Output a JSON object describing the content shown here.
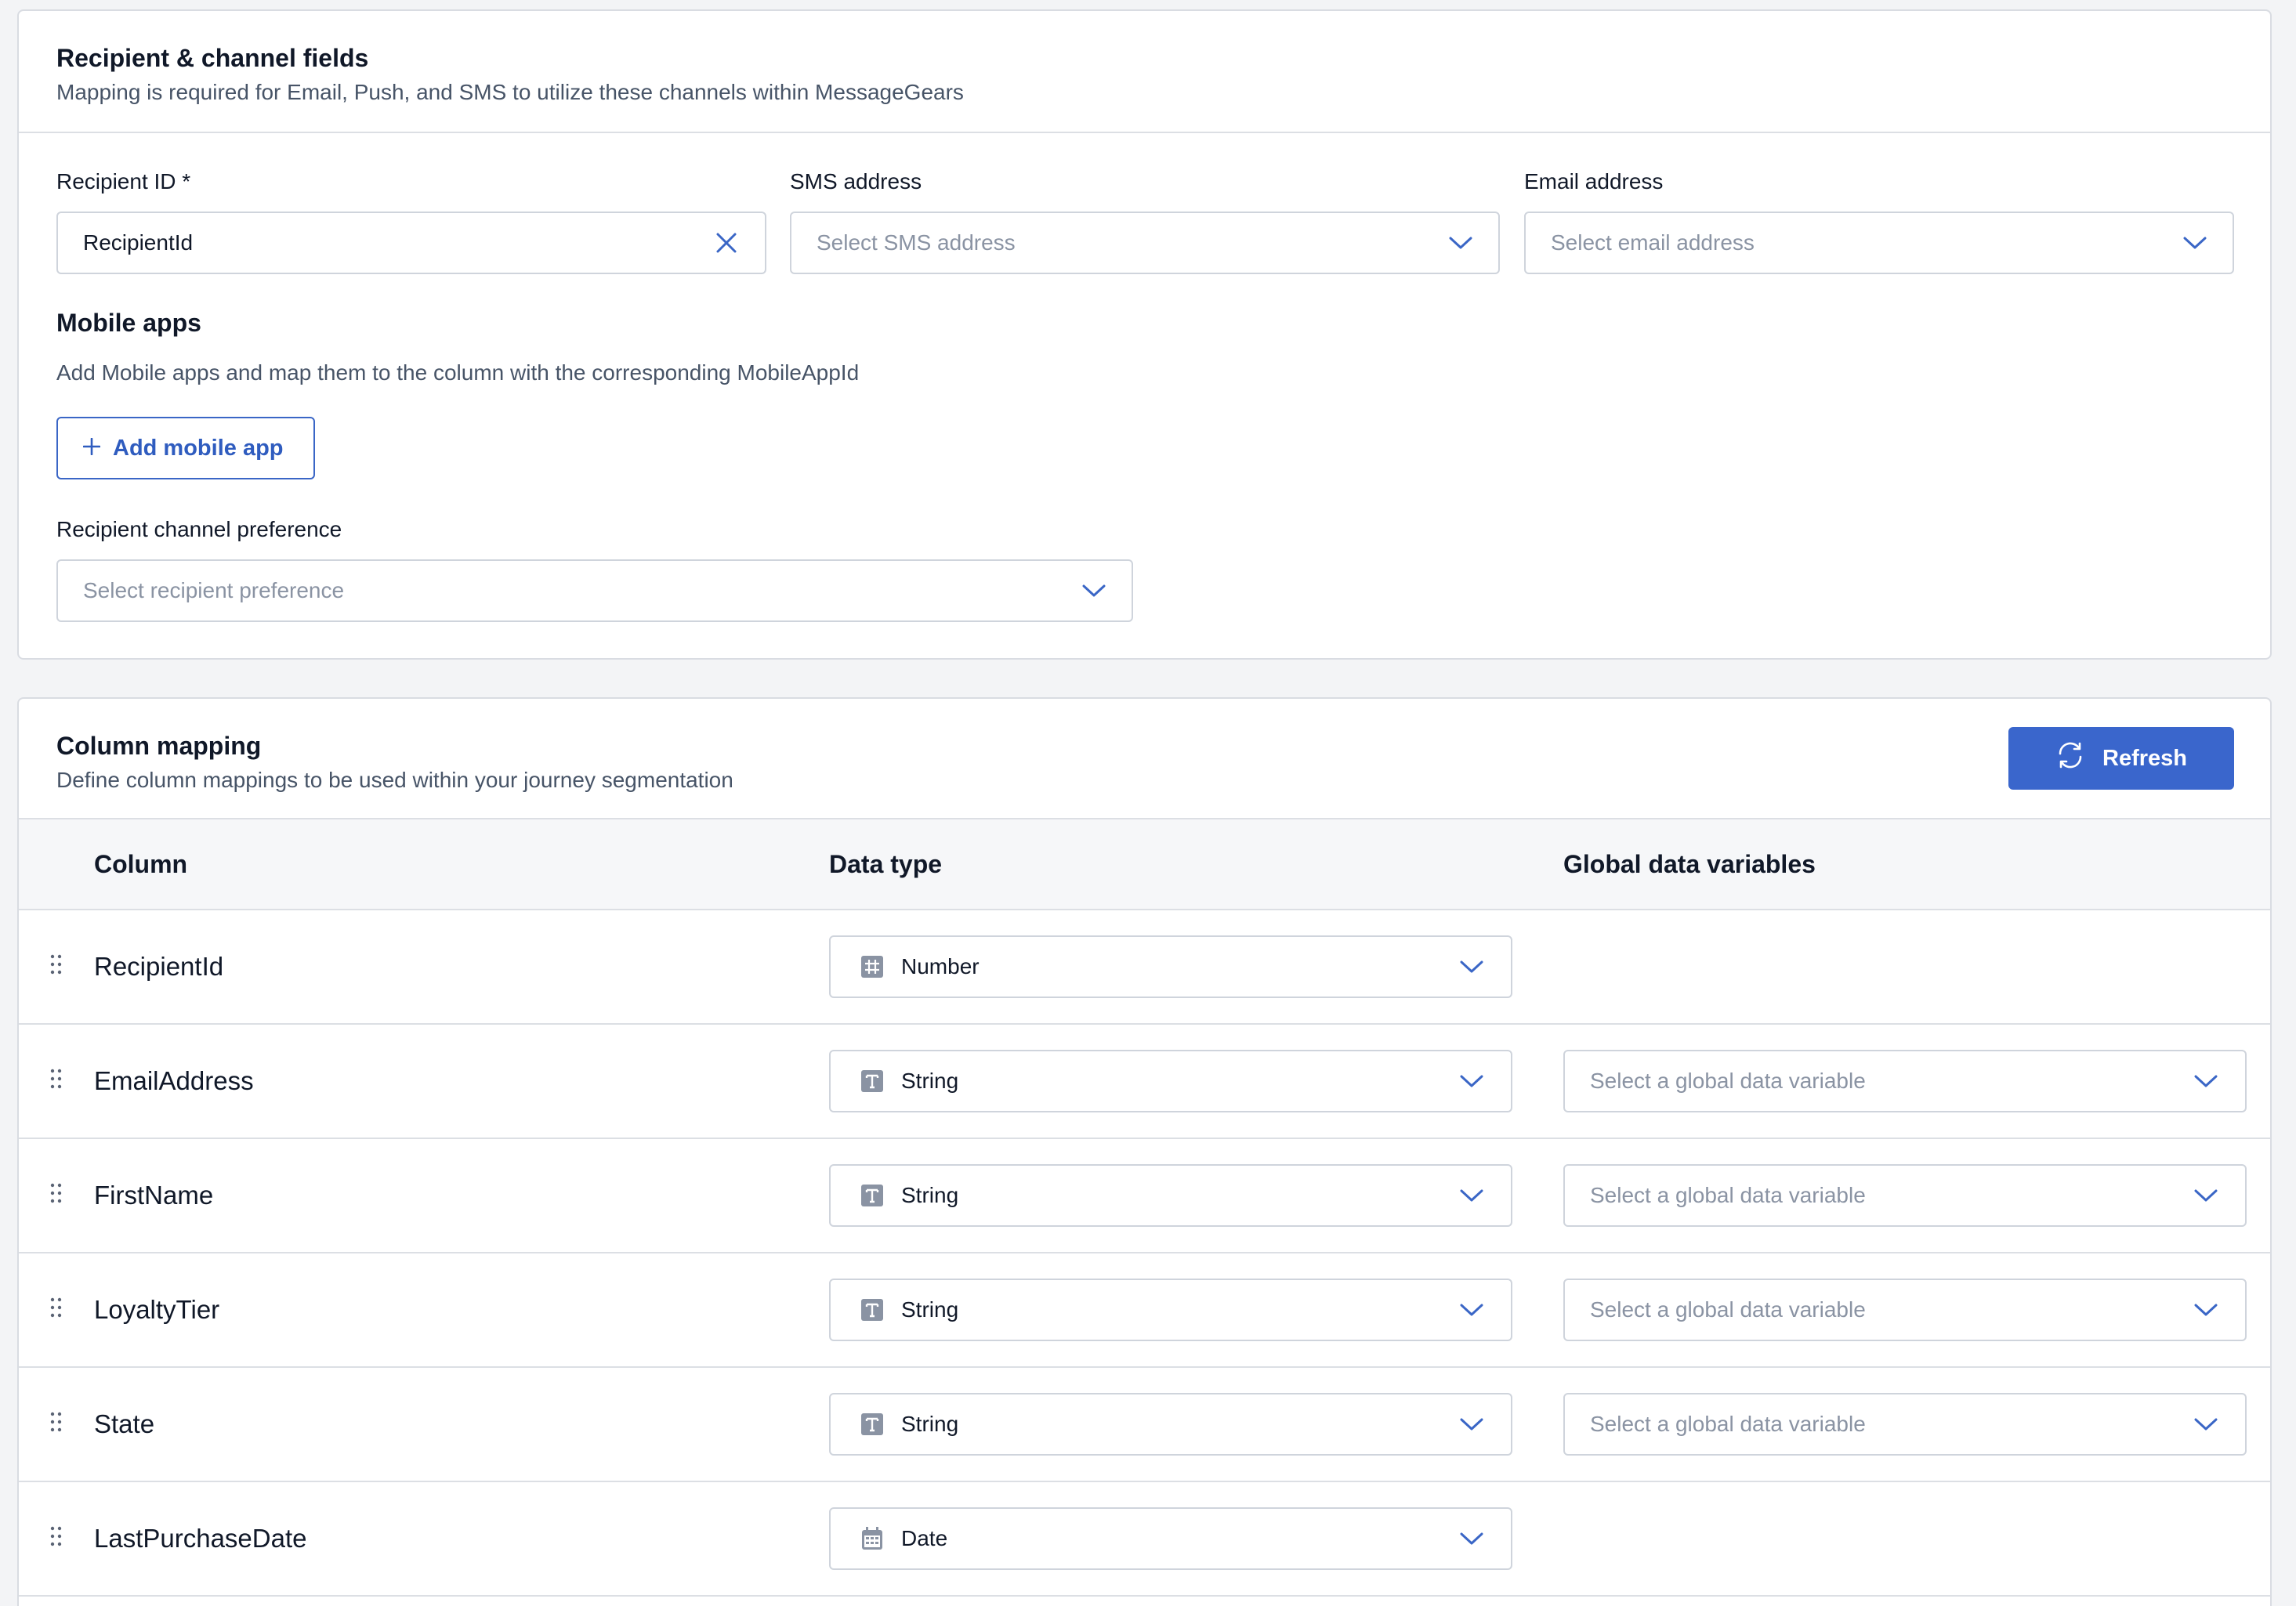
{
  "recipient_card": {
    "title": "Recipient & channel fields",
    "subtitle": "Mapping is required for Email, Push, and SMS to utilize these channels within MessageGears",
    "recipient_id": {
      "label": "Recipient ID *",
      "value": "RecipientId"
    },
    "sms_address": {
      "label": "SMS address",
      "placeholder": "Select SMS address"
    },
    "email_address": {
      "label": "Email address",
      "placeholder": "Select email address"
    },
    "mobile_apps": {
      "title": "Mobile apps",
      "description": "Add Mobile apps and map them to the column with the corresponding MobileAppId",
      "add_button": "Add mobile app"
    },
    "channel_preference": {
      "label": "Recipient channel preference",
      "placeholder": "Select recipient preference"
    }
  },
  "column_card": {
    "title": "Column mapping",
    "subtitle": "Define column mappings to be used within your journey segmentation",
    "refresh_button": "Refresh",
    "headers": {
      "column": "Column",
      "data_type": "Data type",
      "global_vars": "Global data variables"
    },
    "rows": [
      {
        "column": "RecipientId",
        "data_type": "Number",
        "type_icon": "number-icon",
        "global_var_placeholder": null
      },
      {
        "column": "EmailAddress",
        "data_type": "String",
        "type_icon": "string-icon",
        "global_var_placeholder": "Select a global data variable"
      },
      {
        "column": "FirstName",
        "data_type": "String",
        "type_icon": "string-icon",
        "global_var_placeholder": "Select a global data variable"
      },
      {
        "column": "LoyaltyTier",
        "data_type": "String",
        "type_icon": "string-icon",
        "global_var_placeholder": "Select a global data variable"
      },
      {
        "column": "State",
        "data_type": "String",
        "type_icon": "string-icon",
        "global_var_placeholder": "Select a global data variable"
      },
      {
        "column": "LastPurchaseDate",
        "data_type": "Date",
        "type_icon": "calendar-icon",
        "global_var_placeholder": null
      }
    ]
  },
  "colors": {
    "primary": "#3a66cc",
    "border": "#cfd4dc",
    "placeholder": "#8a93a3",
    "page_background": "#f3f4f6"
  }
}
